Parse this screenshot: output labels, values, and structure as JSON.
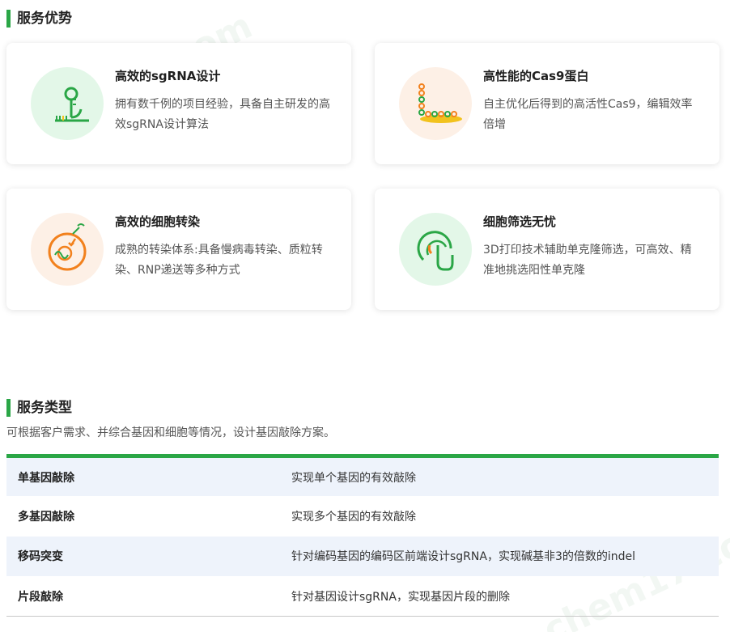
{
  "advantages": {
    "title": "服务优势",
    "cards": [
      {
        "title": "高效的sgRNA设计",
        "desc": "拥有数千例的项目经验，具备自主研发的高效sgRNA设计算法"
      },
      {
        "title": "高性能的Cas9蛋白",
        "desc": "自主优化后得到的高活性Cas9，编辑效率倍增"
      },
      {
        "title": "高效的细胞转染",
        "desc": "成熟的转染体系:具备慢病毒转染、质粒转染、RNP递送等多种方式"
      },
      {
        "title": "细胞筛选无忧",
        "desc": "3D打印技术辅助单克隆筛选，可高效、精准地挑选阳性单克隆"
      }
    ]
  },
  "types": {
    "title": "服务类型",
    "subtitle": "可根据客户需求、并综合基因和细胞等情况，设计基因敲除方案。",
    "rows": [
      {
        "name": "单基因敲除",
        "desc": "实现单个基因的有效敲除"
      },
      {
        "name": "多基因敲除",
        "desc": "实现多个基因的有效敲除"
      },
      {
        "name": "移码突变",
        "desc": "针对编码基因的编码区前端设计sgRNA，实现碱基非3的倍数的indel"
      },
      {
        "name": "片段敲除",
        "desc": "针对基因设计sgRNA，实现基因片段的删除"
      }
    ]
  },
  "watermark": "chem17.com",
  "colors": {
    "accent": "#2aa646",
    "green_bg": "#e3f7e8",
    "orange_bg": "#fdf0e6",
    "orange": "#f2811d"
  }
}
